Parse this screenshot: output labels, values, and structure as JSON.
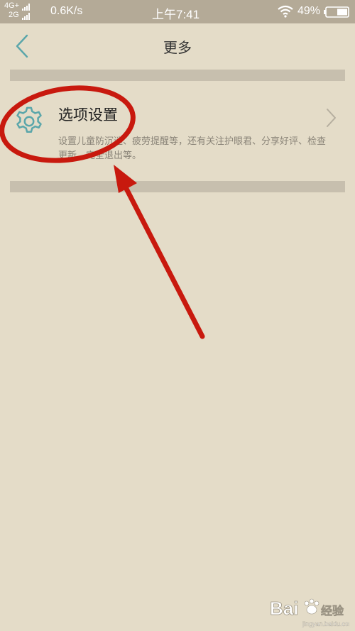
{
  "status_bar": {
    "network_line1": "4G+",
    "network_line2": "2G",
    "speed": "0.6K/s",
    "time": "上午7:41",
    "battery": "49%"
  },
  "header": {
    "title": "更多",
    "back_icon": "chevron-left-icon"
  },
  "option": {
    "icon": "gear-icon",
    "title": "选项设置",
    "description": "设置儿童防沉迷、疲劳提醒等，还有关注护眼君、分享好评、检查更新、完全退出等。",
    "chevron_icon": "chevron-right-icon"
  },
  "watermark": {
    "brand": "Bai",
    "brand_suffix": "经验",
    "domain": "jingyan.baidu.com"
  },
  "colors": {
    "background": "#e4dcc8",
    "status_bar": "#b4aa97",
    "divider": "#c7bfae",
    "accent": "#5aa6aa",
    "annotation_red": "#c8190e"
  }
}
